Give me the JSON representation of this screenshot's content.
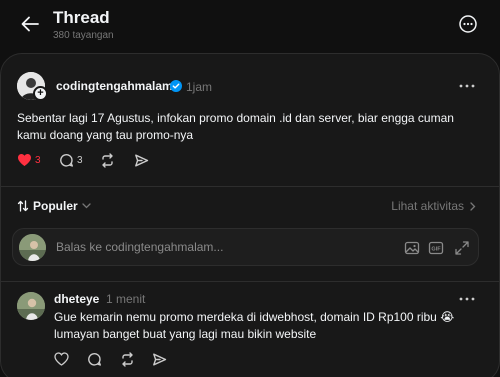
{
  "header": {
    "title": "Thread",
    "views": "380 tayangan"
  },
  "post": {
    "author": "codingtengahmalam",
    "time": "1jam",
    "text": "Sebentar lagi 17 Agustus, infokan promo domain .id dan server, biar engga cuman kamu doang yang tau promo-nya",
    "likes": "3",
    "comments": "3",
    "like_color": "#ff3040"
  },
  "sort": {
    "label": "Populer",
    "activity": "Lihat aktivitas"
  },
  "reply_box": {
    "placeholder": "Balas ke codingtengahmalam..."
  },
  "reply": {
    "author": "dheteye",
    "time": "1 menit",
    "text": "Gue kemarin nemu promo merdeka di idwebhost, domain ID Rp100 ribu 😭 lumayan banget buat yang lagi mau bikin website"
  },
  "icons": {
    "back": "arrow-left-icon",
    "more": "more-circle-icon",
    "verified": "verified-badge-icon",
    "like": "heart-icon",
    "comment": "comment-icon",
    "repost": "repost-icon",
    "share": "share-icon",
    "sort": "sort-arrows-icon",
    "image": "image-icon",
    "gif": "gif-icon",
    "expand": "expand-icon"
  }
}
